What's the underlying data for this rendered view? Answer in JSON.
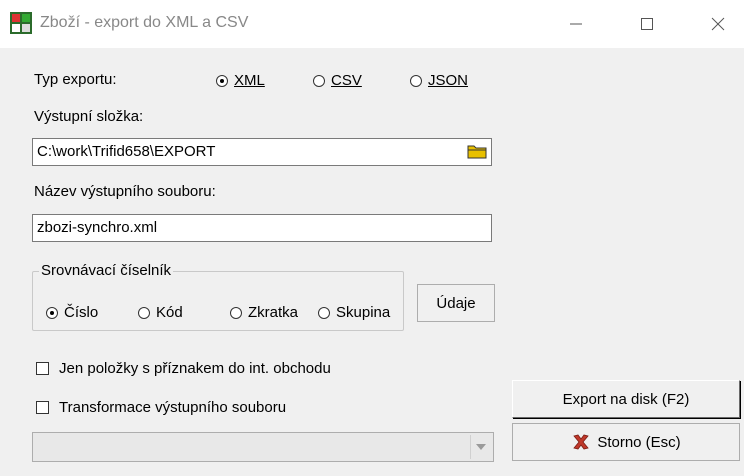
{
  "window": {
    "title": "Zboží - export do XML a CSV"
  },
  "export_type": {
    "label": "Typ exportu:",
    "options": [
      {
        "label": "XML",
        "selected": true
      },
      {
        "label": "CSV",
        "selected": false
      },
      {
        "label": "JSON",
        "selected": false
      }
    ]
  },
  "output_folder": {
    "label": "Výstupní složka:",
    "value": "C:\\work\\Trifid658\\EXPORT"
  },
  "output_file": {
    "label": "Název výstupního souboru:",
    "value": "zbozi-synchro.xml"
  },
  "compare_codebook": {
    "title": "Srovnávací číselník",
    "options": [
      {
        "label": "Číslo",
        "selected": true
      },
      {
        "label": "Kód",
        "selected": false
      },
      {
        "label": "Zkratka",
        "selected": false
      },
      {
        "label": "Skupina",
        "selected": false
      }
    ],
    "data_button": "Údaje"
  },
  "checkboxes": {
    "intra_trade": {
      "label": "Jen položky s příznakem do int. obchodu",
      "checked": false
    },
    "transform": {
      "label": "Transformace výstupního souboru",
      "checked": false
    }
  },
  "transform_select": {
    "value": ""
  },
  "buttons": {
    "export": "Export na disk (F2)",
    "cancel": "Storno (Esc)"
  },
  "colors": {
    "cancel_icon": "#c0392b",
    "folder_icon": "#e8c000"
  }
}
